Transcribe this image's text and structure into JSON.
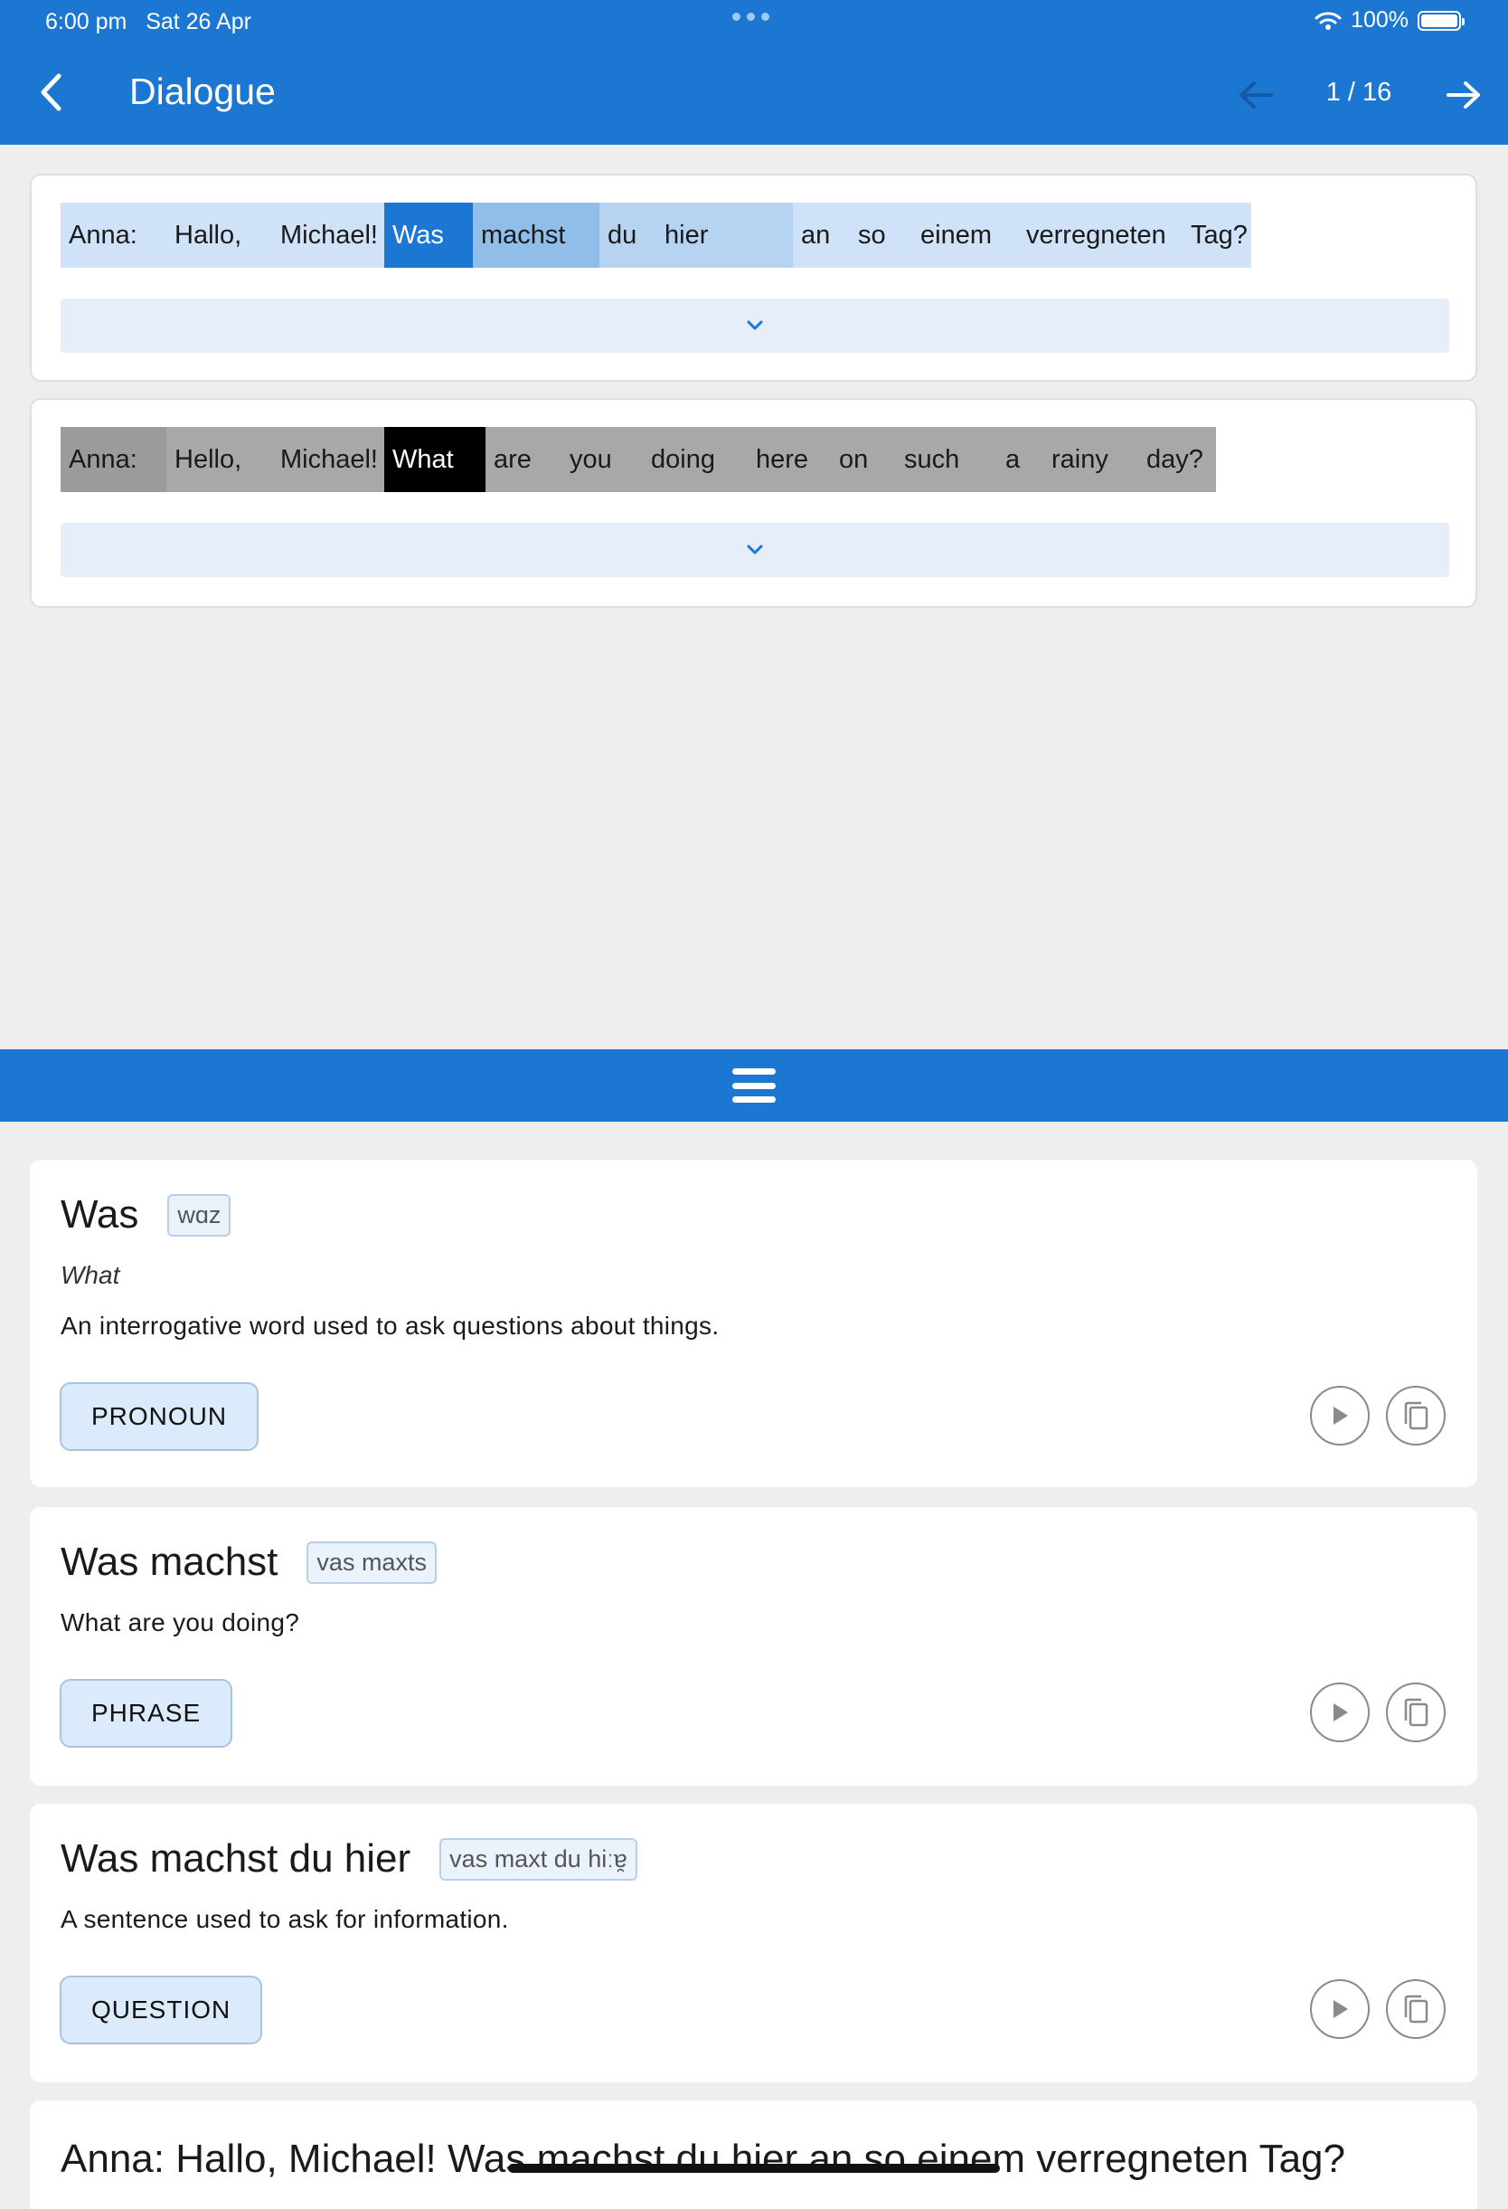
{
  "status_bar": {
    "time": "6:00 pm",
    "date": "Sat 26 Apr",
    "battery": "100%"
  },
  "app_bar": {
    "title": "Dialogue",
    "page_counter": "1 / 16"
  },
  "german_sentence": {
    "words": [
      "Anna:",
      "Hallo,",
      "Michael!",
      "Was",
      "machst",
      "du",
      "hier",
      "an",
      "so",
      "einem",
      "verregneten",
      "Tag?"
    ]
  },
  "english_sentence": {
    "words": [
      "Anna:",
      "Hello,",
      "Michael!",
      "What",
      "are",
      "you",
      "doing",
      "here",
      "on",
      "such",
      "a",
      "rainy",
      "day?"
    ]
  },
  "vocab": [
    {
      "term": "Was",
      "ipa": "wɑz",
      "translation": "What",
      "definition": "An interrogative word used to ask questions about things.",
      "pos": "PRONOUN"
    },
    {
      "term": "Was machst",
      "ipa": "vas maxts",
      "definition": "What are you doing?",
      "pos": "PHRASE"
    },
    {
      "term": "Was machst du hier",
      "ipa": "vas maxt du hiːɐ̯",
      "definition": "A sentence used to ask for information.",
      "pos": "QUESTION"
    }
  ],
  "sentence_peek": {
    "text": "Anna: Hallo, Michael! Was machst du hier an so einem verregneten Tag?"
  },
  "icons": {
    "back": "chevron-left-icon",
    "prev": "arrow-left-icon",
    "next": "arrow-right-icon",
    "expand": "chevron-down-icon",
    "menu": "hamburger-menu-icon",
    "play": "play-icon",
    "copy": "copy-icon",
    "wifi": "wifi-icon",
    "battery": "battery-icon"
  },
  "colors": {
    "primary": "#1b77d2",
    "highlight_light": "#cfe2f7",
    "highlight_selected": "#1b77d2",
    "english_selected": "#000000"
  }
}
